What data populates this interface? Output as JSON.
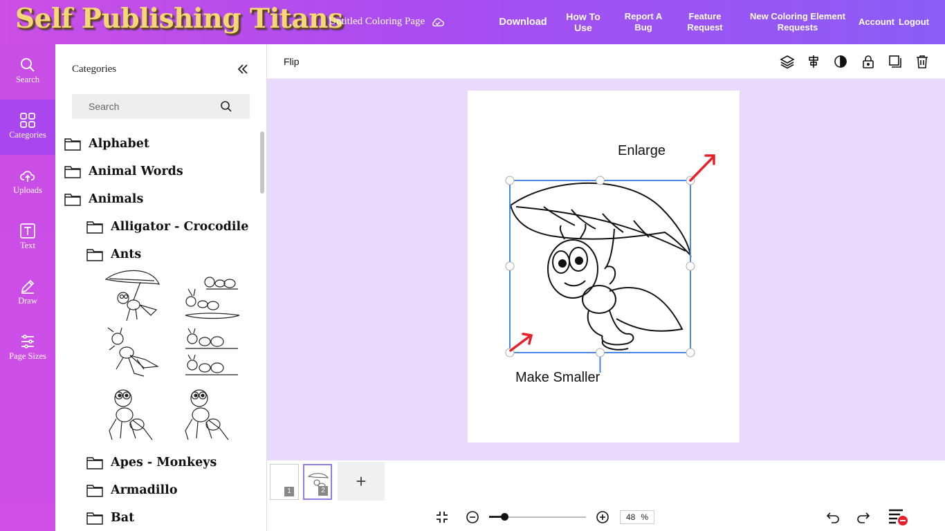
{
  "header": {
    "logo_text": "Self Publishing Titans",
    "document_title": "Untitled Coloring Page",
    "nav": {
      "download": "Download",
      "how_to_use": "How To Use",
      "report_bug": "Report A Bug",
      "feature_request": "Feature Request",
      "new_elements": "New Coloring Element Requests",
      "account": "Account",
      "logout": "Logout"
    }
  },
  "rail": {
    "items": [
      {
        "label": "Search",
        "icon": "search-icon"
      },
      {
        "label": "Categories",
        "icon": "grid-icon",
        "active": true
      },
      {
        "label": "Uploads",
        "icon": "upload-cloud-icon"
      },
      {
        "label": "Text",
        "icon": "text-icon"
      },
      {
        "label": "Draw",
        "icon": "pencil-icon"
      },
      {
        "label": "Page Sizes",
        "icon": "sliders-icon"
      }
    ]
  },
  "panel": {
    "title": "Categories",
    "search_placeholder": "Search",
    "categories": [
      {
        "label": "Alphabet",
        "level": 0
      },
      {
        "label": "Animal Words",
        "level": 0
      },
      {
        "label": "Animals",
        "level": 0
      },
      {
        "label": "Alligator - Crocodile",
        "level": 1
      },
      {
        "label": "Ants",
        "level": 1
      },
      {
        "label": "Apes - Monkeys",
        "level": 1
      },
      {
        "label": "Armadillo",
        "level": 1
      },
      {
        "label": "Bat",
        "level": 1
      }
    ],
    "ant_thumbnails": [
      "ant-with-leaf",
      "ants-group",
      "ant-running",
      "ants-line",
      "ant-smiling",
      "ant-smiling-2"
    ]
  },
  "toolbar": {
    "flip_label": "Flip",
    "tools": [
      "layers-icon",
      "align-icon",
      "contrast-icon",
      "lock-icon",
      "duplicate-icon",
      "trash-icon"
    ]
  },
  "canvas": {
    "annotation_enlarge": "Enlarge",
    "annotation_smaller": "Make Smaller",
    "accent_color": "#4a86e8",
    "arrow_color": "#e8202a"
  },
  "pages": {
    "thumbnails": [
      {
        "number": "1"
      },
      {
        "number": "2",
        "active": true
      }
    ],
    "add_label": "+"
  },
  "zoom": {
    "value": "48",
    "unit": "%",
    "level_fraction": 0.16
  },
  "colors": {
    "header_start": "#cc4fe6",
    "header_end": "#8b5cf6",
    "rail": "#c84ee6",
    "rail_active": "#a946ee",
    "canvas_bg": "#e9d9fd"
  }
}
